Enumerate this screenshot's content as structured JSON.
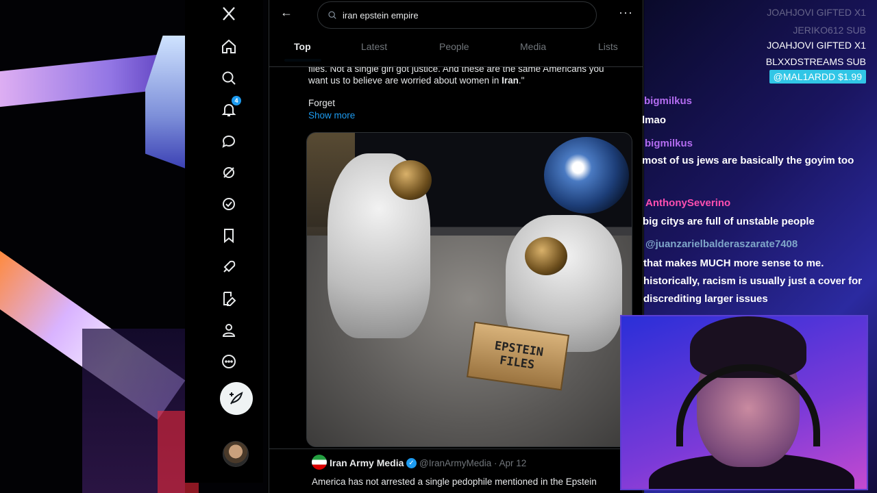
{
  "nav": {
    "notifications_badge": "4",
    "items": [
      "x-logo-icon",
      "home-icon",
      "search-icon",
      "bell-icon",
      "message-icon",
      "grok-icon",
      "verified-icon",
      "bookmark-icon",
      "rocket-icon",
      "edit-icon",
      "profile-icon",
      "more-icon"
    ]
  },
  "search": {
    "value": "iran epstein empire"
  },
  "tabs": [
    "Top",
    "Latest",
    "People",
    "Media",
    "Lists"
  ],
  "tweet1": {
    "text_line1": "files. Not a single girl got justice. And these are the same Americans you",
    "text_line2_pre": "want us to believe are worried about women in ",
    "text_line2_bold": "Iran",
    "text_line2_post": ".\"",
    "text_line3": "Forget",
    "show_more": "Show more",
    "image_box_line1": "EPSTEIN",
    "image_box_line2": "FILES"
  },
  "tweet2": {
    "name": "Iran Army Media",
    "handle": "@IranArmyMedia · Apr 12",
    "body": "America has not arrested a single pedophile mentioned in the Epstein"
  },
  "subs": [
    {
      "text": "JOAHJOVI  GIFTED X1",
      "style": "faded"
    },
    {
      "text": "JERIKO612  SUB",
      "style": "faded"
    },
    {
      "text": "JOAHJOVI  GIFTED X1",
      "style": "bright"
    },
    {
      "text": "BLXXDSTREAMS  SUB",
      "style": "bright"
    },
    {
      "text": "@MAL1ARDD  $1.99",
      "style": "hl"
    }
  ],
  "chat": [
    {
      "user": "bigmilkus",
      "color": "#b36cf0",
      "msg": "lmao"
    },
    {
      "user": "bigmilkus",
      "color": "#b36cf0",
      "msg": "most of us jews are basically the goyim too"
    },
    {
      "user": "AnthonySeverino",
      "color": "#ff4fb0",
      "msg": "big citys are full of unstable people"
    },
    {
      "user": "@juanzarielbalderaszarate7408",
      "color": "#7fa6c9",
      "msg": "that makes MUCH more sense to me. historically, racism is usually just a cover for discrediting larger issues"
    }
  ]
}
